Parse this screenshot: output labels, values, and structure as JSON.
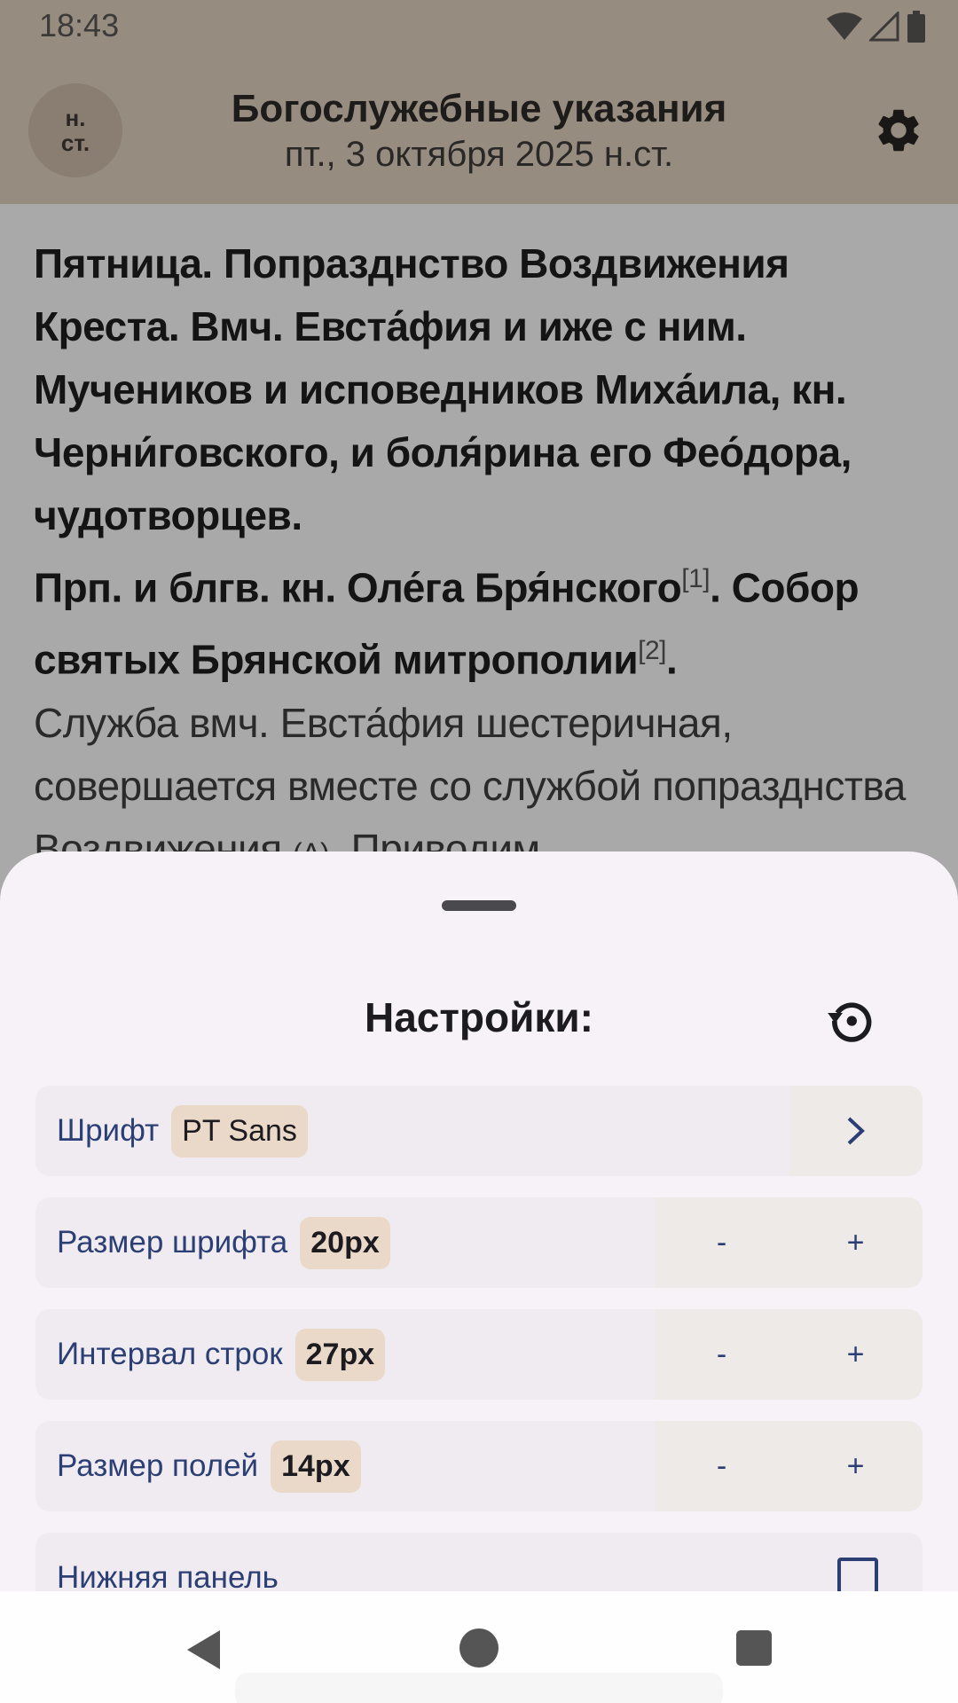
{
  "status": {
    "time": "18:43"
  },
  "header": {
    "calendar_line1": "н.",
    "calendar_line2": "ст.",
    "title": "Богослужебные указания",
    "subtitle": "пт., 3 октября 2025 н.ст."
  },
  "content": {
    "p1": "Пятница. Попразднство Воздвижения Креста. Вмч. Евста́фия и иже с ним. Мучеников и исповедников Миха́ила, кн. Черни́говского, и боля́рина его Фео́дора, чудотворцев.",
    "p2a": "Прп. и блгв. кн. Оле́га Бря́нского",
    "fn1": "[1]",
    "p2b": ". Собор святых Брянской митрополии",
    "fn2": "[2]",
    "p2c": ".",
    "p3a": "Служба вмч. Евста́фия шестеричная, совершается вместе со службой попразднства Воздвижения ",
    "p3_mark": "(А)",
    "p3b": ". Приводим"
  },
  "sheet": {
    "title": "Настройки:",
    "rows": [
      {
        "label": "Шрифт",
        "value": "PT Sans",
        "action": "›"
      },
      {
        "label": "Размер шрифта",
        "value": "20px",
        "minus": "-",
        "plus": "+"
      },
      {
        "label": "Интервал строк",
        "value": "27px",
        "minus": "-",
        "plus": "+"
      },
      {
        "label": "Размер полей",
        "value": "14px",
        "minus": "-",
        "plus": "+"
      },
      {
        "label": "Нижняя панель",
        "checked": false
      }
    ]
  },
  "colors": {
    "accent": "#2c3f74",
    "chip": "#ead9c8",
    "appbar": "#978c80"
  },
  "icons": [
    "wifi-icon",
    "signal-icon",
    "battery-icon",
    "gear-icon",
    "reset-icon",
    "chevron-right-icon",
    "back-icon",
    "home-icon",
    "recents-icon"
  ]
}
